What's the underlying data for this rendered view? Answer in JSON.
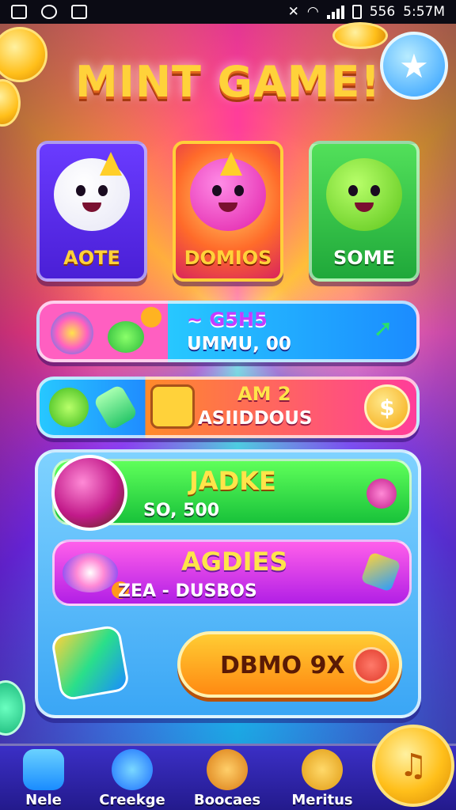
{
  "status_bar": {
    "right_text": "5:57M",
    "battery_text": "556"
  },
  "title": "MINT GAME!",
  "cards": [
    {
      "name": "AOTE"
    },
    {
      "name": "DOMIOS"
    },
    {
      "name": "SOME"
    }
  ],
  "rows": [
    {
      "line1": "~ G5H5",
      "line2": "UMMU, 00"
    },
    {
      "line1": "AM 2",
      "line2": "ASIIDDOUS"
    }
  ],
  "panel": {
    "bar1": {
      "title": "JADKE",
      "sub": "SO, 500"
    },
    "bar2": {
      "title": "AGDIES",
      "sub": "ZEA - DUSBOS"
    },
    "cta": {
      "label": "DBMO 9X"
    }
  },
  "nav": [
    {
      "label": "Nele",
      "icon": "hand-icon"
    },
    {
      "label": "Creekge",
      "icon": "music-disc-icon"
    },
    {
      "label": "Boocaes",
      "icon": "harp-icon"
    },
    {
      "label": "Meritus",
      "icon": "note-coin-icon"
    }
  ],
  "colors": {
    "accent": "#ffd23a",
    "nav_bg": "#2e23a8",
    "cta": "#ff9a1a"
  }
}
